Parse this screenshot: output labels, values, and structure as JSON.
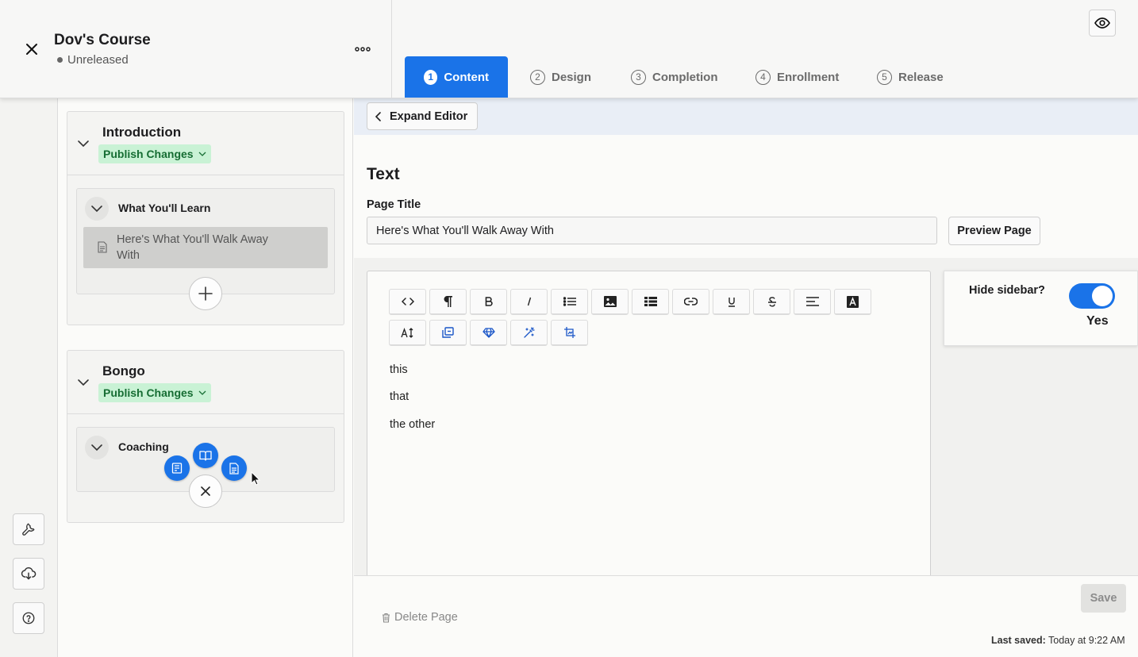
{
  "header": {
    "course_title": "Dov's Course",
    "course_status": "Unreleased",
    "tabs": [
      {
        "num": "1",
        "label": "Content",
        "active": true
      },
      {
        "num": "2",
        "label": "Design",
        "active": false
      },
      {
        "num": "3",
        "label": "Completion",
        "active": false
      },
      {
        "num": "4",
        "label": "Enrollment",
        "active": false
      },
      {
        "num": "5",
        "label": "Release",
        "active": false
      }
    ],
    "icons": {
      "close": "close-icon",
      "more": "more-horizontal-icon",
      "preview": "eye-icon"
    }
  },
  "left_rail": {
    "icons": [
      "wrench-icon",
      "cloud-download-icon",
      "help-circle-icon"
    ]
  },
  "outline": {
    "sections": [
      {
        "title": "Introduction",
        "badge": "Publish Changes",
        "lessons": [
          {
            "title": "What You'll Learn",
            "pages": [
              "Here's What You'll Walk Away With"
            ]
          }
        ]
      },
      {
        "title": "Bongo",
        "badge": "Publish Changes",
        "lessons": [
          {
            "title": "Coaching",
            "pages": []
          }
        ]
      }
    ],
    "add_menu_icons": [
      "quiz-icon",
      "book-open-icon",
      "document-icon"
    ]
  },
  "editor": {
    "expand_label": "Expand Editor",
    "section_type": "Text",
    "page_title_label": "Page Title",
    "page_title_value": "Here's What You'll Walk Away With",
    "preview_label": "Preview Page",
    "toolbar_row1": [
      "code-view-icon",
      "paragraph-icon",
      "bold-icon",
      "italic-icon",
      "bullet-list-icon",
      "image-icon",
      "table-icon",
      "link-icon",
      "underline-icon",
      "strikethrough-icon",
      "align-icon",
      "text-color-icon"
    ],
    "toolbar_row2": [
      "font-size-icon",
      "embed-icon",
      "gem-icon",
      "magic-wand-icon",
      "crop-image-icon"
    ],
    "content_lines": [
      "this",
      "that",
      "the other"
    ],
    "hide_sidebar_label": "Hide sidebar?",
    "hide_sidebar_value": "Yes",
    "delete_label": "Delete Page",
    "save_label": "Save",
    "last_saved_label": "Last saved:",
    "last_saved_value": "Today at 9:22 AM"
  },
  "colors": {
    "accent": "#1a73e8",
    "badge_bg": "#c9f2d5",
    "badge_text": "#166d33"
  }
}
